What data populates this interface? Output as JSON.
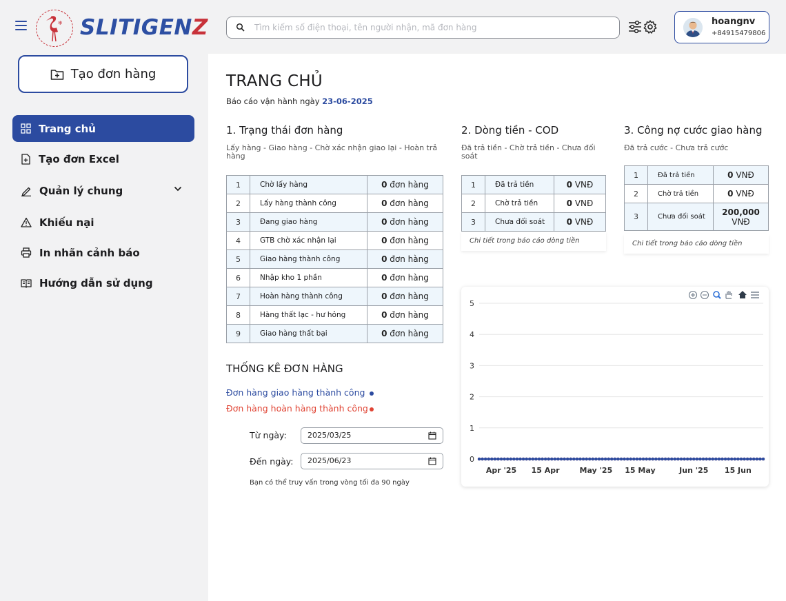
{
  "brand": {
    "logo_text_main": "SLITIGEN",
    "logo_text_accent": "Z"
  },
  "search": {
    "placeholder": "Tìm kiếm số điện thoại, tên người nhận, mã đơn hàng",
    "value": ""
  },
  "user": {
    "name": "hoangnv",
    "phone": "+84915479806"
  },
  "sidebar": {
    "create_label": "Tạo đơn hàng",
    "items": [
      {
        "label": "Trang chủ",
        "icon": "grid-icon",
        "active": true
      },
      {
        "label": "Tạo đơn Excel",
        "icon": "file-add-icon"
      },
      {
        "label": "Quản lý chung",
        "icon": "pen-icon",
        "expandable": true
      },
      {
        "label": "Khiếu nại",
        "icon": "warning-icon"
      },
      {
        "label": "In nhãn cảnh báo",
        "icon": "printer-icon"
      },
      {
        "label": "Hướng dẫn sử dụng",
        "icon": "book-icon"
      }
    ]
  },
  "page": {
    "title": "TRANG CHỦ",
    "report_prefix": "Báo cáo vận hành ngày",
    "report_date": "23-06-2025"
  },
  "order_status": {
    "title": "1. Trạng thái đơn hàng",
    "subtitle": "Lấy hàng - Giao hàng - Chờ xác nhận giao lại - Hoàn trả hàng",
    "unit": "đơn hàng",
    "rows": [
      {
        "no": "1",
        "label": "Chờ lấy hàng",
        "count": "0"
      },
      {
        "no": "2",
        "label": "Lấy hàng thành công",
        "count": "0"
      },
      {
        "no": "3",
        "label": "Đang giao hàng",
        "count": "0"
      },
      {
        "no": "4",
        "label": "GTB chờ xác nhận lại",
        "count": "0"
      },
      {
        "no": "5",
        "label": "Giao hàng thành công",
        "count": "0"
      },
      {
        "no": "6",
        "label": "Nhập kho 1 phần",
        "count": "0"
      },
      {
        "no": "7",
        "label": "Hoàn hàng thành công",
        "count": "0"
      },
      {
        "no": "8",
        "label": "Hàng thất lạc - hư hỏng",
        "count": "0"
      },
      {
        "no": "9",
        "label": "Giao hàng thất bại",
        "count": "0"
      }
    ]
  },
  "cod": {
    "title": "2. Dòng tiền - COD",
    "subtitle": "Đã trả tiền - Chờ trả tiền - Chưa đối soát",
    "unit": "VNĐ",
    "rows": [
      {
        "no": "1",
        "label": "Đã trả tiền",
        "amount": "0"
      },
      {
        "no": "2",
        "label": "Chờ trả tiền",
        "amount": "0"
      },
      {
        "no": "3",
        "label": "Chưa đối soát",
        "amount": "0"
      }
    ],
    "footer": "Chi tiết trong báo cáo dòng tiền"
  },
  "debt": {
    "title": "3. Công nợ cước giao hàng",
    "subtitle": "Đã trả cước - Chưa trả cước",
    "unit": "VNĐ",
    "rows": [
      {
        "no": "1",
        "label": "Đã trả tiền",
        "amount": "0"
      },
      {
        "no": "2",
        "label": "Chờ trả tiền",
        "amount": "0"
      },
      {
        "no": "3",
        "label": "Chưa đối soát",
        "amount": "200,000"
      }
    ],
    "footer": "Chi tiết trong báo cáo dòng tiền"
  },
  "stats": {
    "title": "THỐNG KÊ ĐƠN HÀNG",
    "legend": [
      {
        "label": "Đơn hàng giao hàng thành công",
        "color": "#2c4ba0"
      },
      {
        "label": "Đơn hàng hoàn hàng thành công",
        "color": "#e04434"
      }
    ],
    "from_label": "Từ ngày:",
    "from_value": "2025/03/25",
    "to_label": "Đến ngày:",
    "to_value": "2025/06/23",
    "note": "Bạn có thể truy vấn trong vòng tối đa 90 ngày"
  },
  "chart_data": {
    "type": "line",
    "x_tick_labels": [
      "Apr '25",
      "15 Apr",
      "May '25",
      "15 May",
      "Jun '25",
      "15 Jun"
    ],
    "y_ticks": [
      0,
      1,
      2,
      3,
      4,
      5
    ],
    "ylim": [
      0,
      5
    ],
    "xlim": [
      "2025-03-25",
      "2025-06-23"
    ],
    "grid": true,
    "toolbar": [
      "zoom-in-icon",
      "zoom-out-icon",
      "zoom-select-icon",
      "pan-icon",
      "home-icon",
      "menu-icon"
    ],
    "series": [
      {
        "color": "#2c4ba0",
        "value_all_days": 0
      },
      {
        "color": "#e04434",
        "value_all_days": 0
      }
    ]
  }
}
